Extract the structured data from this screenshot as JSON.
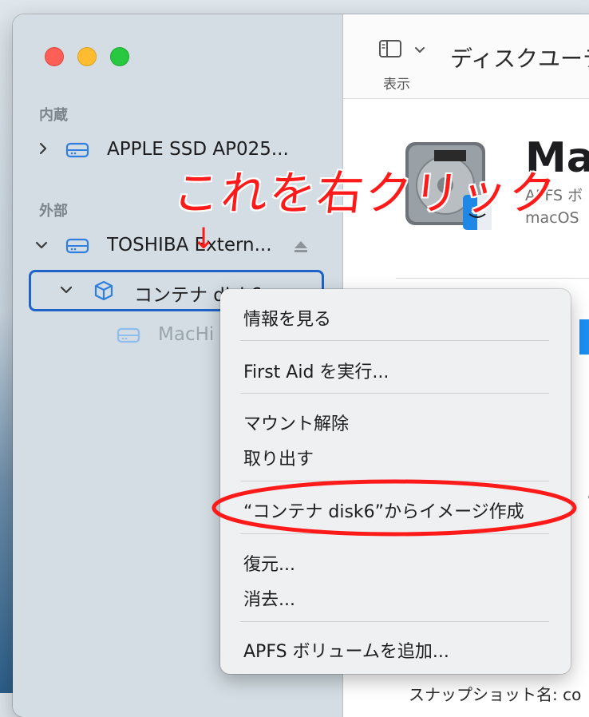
{
  "sidebar": {
    "section_internal": "内蔵",
    "internal_disk": "APPLE SSD AP025...",
    "section_external": "外部",
    "external_disk": "TOSHIBA Extern...",
    "container": "コンテナ disk6",
    "volume": "MacHi"
  },
  "toolbar": {
    "show_label": "表示",
    "title": "ディスクユーティ"
  },
  "detail": {
    "volume_name": "Mac",
    "volume_type": "APFS ボ",
    "volume_os": "macOS",
    "snapshot_label": "スナップショット名:",
    "snapshot_value": "co",
    "partial_text": "み"
  },
  "annotation": {
    "text": "これを右クリック",
    "arrow": "↓"
  },
  "context_menu": {
    "item_info": "情報を見る",
    "item_first_aid": "First Aid を実行...",
    "item_unmount": "マウント解除",
    "item_eject": "取り出す",
    "item_image": "“コンテナ disk6”からイメージ作成",
    "item_restore": "復元...",
    "item_erase": "消去...",
    "item_add_volume": "APFS ボリュームを追加..."
  },
  "colors": {
    "accent": "#1f63c8",
    "annotation": "#ff1a1a",
    "disk_icon": "#2f7fe0"
  }
}
